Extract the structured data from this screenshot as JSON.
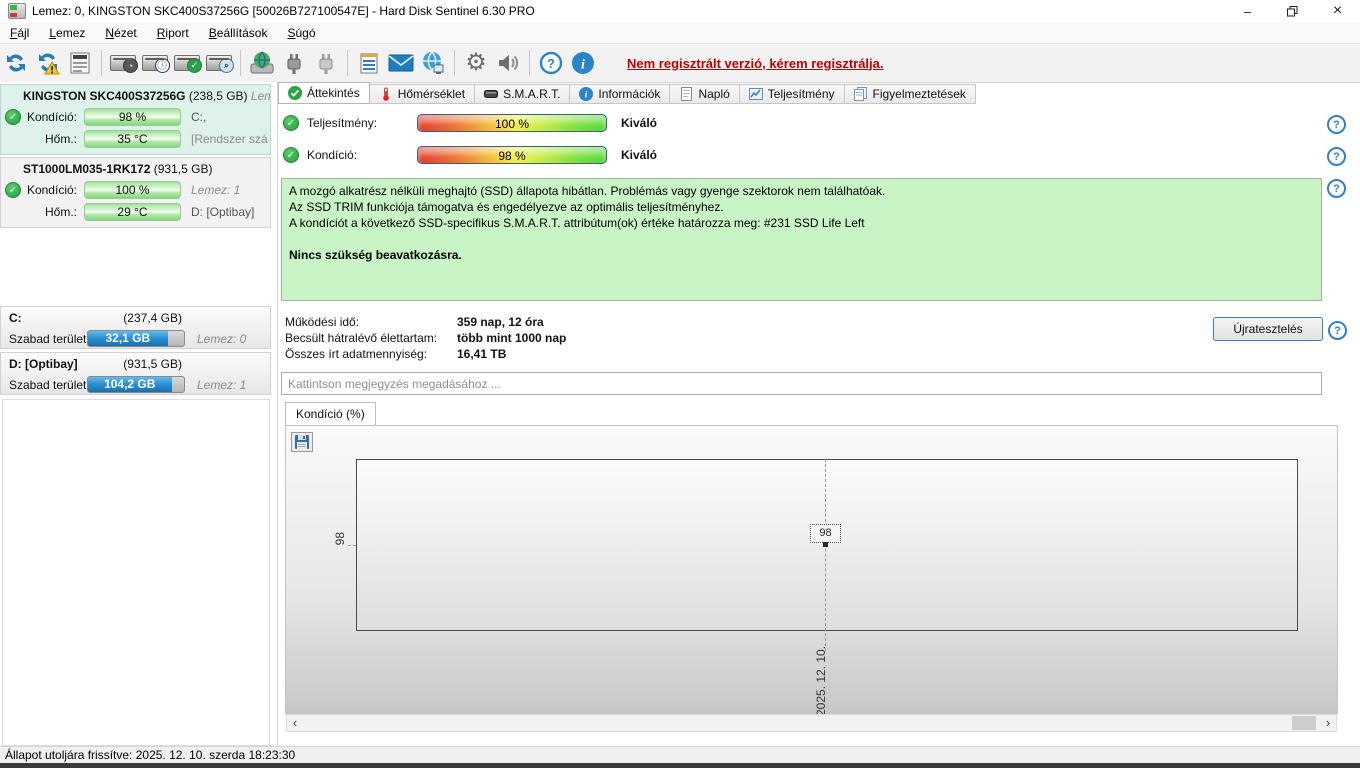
{
  "window": {
    "title": "Lemez: 0, KINGSTON SKC400S37256G [50026B727100547E]  -  Hard Disk Sentinel 6.30 PRO"
  },
  "menu": {
    "items": [
      {
        "label": "Fájl"
      },
      {
        "label": "Lemez"
      },
      {
        "label": "Nézet"
      },
      {
        "label": "Riport"
      },
      {
        "label": "Beállítások"
      },
      {
        "label": "Súgó"
      }
    ]
  },
  "toolbar": {
    "register_text": "Nem regisztrált verzió, kérem regisztrálja."
  },
  "tabs": [
    {
      "label": "Áttekintés",
      "active": true
    },
    {
      "label": "Hőmérséklet"
    },
    {
      "label": "S.M.A.R.T."
    },
    {
      "label": "Információk"
    },
    {
      "label": "Napló"
    },
    {
      "label": "Teljesítmény"
    },
    {
      "label": "Figyelmeztetések"
    }
  ],
  "sidebar": {
    "disks": [
      {
        "name": "KINGSTON SKC400S37256G",
        "size": "(238,5 GB)",
        "extra": "Lem",
        "rows": [
          {
            "label": "Kondíció:",
            "value": "98 %",
            "right": "C:,"
          },
          {
            "label": "Hőm.:",
            "value": "35 °C",
            "right": "[Rendszer szá"
          }
        ]
      },
      {
        "name": "ST1000LM035-1RK172",
        "size": "(931,5 GB)",
        "extra": "",
        "rows": [
          {
            "label": "Kondíció:",
            "value": "100 %",
            "right": "Lemez: 1"
          },
          {
            "label": "Hőm.:",
            "value": "29 °C",
            "right": "D: [Optibay]"
          }
        ]
      }
    ],
    "partitions": [
      {
        "name": "C:",
        "size": "(237,4 GB)",
        "free_label": "Szabad terület",
        "free_value": "32,1 GB",
        "right": "Lemez: 0",
        "used_pct": 86
      },
      {
        "name": "D: [Optibay]",
        "size": "(931,5 GB)",
        "free_label": "Szabad terület",
        "free_value": "104,2 GB",
        "right": "Lemez: 1",
        "used_pct": 89
      }
    ]
  },
  "overview": {
    "performance": {
      "label": "Teljesítmény:",
      "value": "100 %",
      "rating": "Kiváló"
    },
    "condition": {
      "label": "Kondíció:",
      "value": "98 %",
      "rating": "Kiváló"
    },
    "status_lines": [
      "A mozgó alkatrész nélküli meghajtó (SSD) állapota hibátlan. Problémás vagy gyenge szektorok nem találhatóak.",
      "Az SSD TRIM funkciója támogatva és engedélyezve az optimális teljesítményhez.",
      "A kondíciót a következő SSD-specifikus S.M.A.R.T. attribútum(ok) értéke határozza meg:  #231 SSD Life Left"
    ],
    "status_bold": "Nincs szükség beavatkozásra.",
    "stats": [
      {
        "label": "Működési idő:",
        "value": "359 nap, 12 óra"
      },
      {
        "label": "Becsült hátralévő élettartam:",
        "value": "több mint 1000 nap"
      },
      {
        "label": "Összes írt adatmennyiség:",
        "value": "16,41 TB"
      }
    ],
    "retest_button": "Újratesztelés",
    "comment_placeholder": "Kattintson megjegyzés megadásához ..."
  },
  "chart": {
    "tab_label": "Kondíció  (%)",
    "chart_data": {
      "type": "line",
      "title": "Kondíció (%)",
      "series": [
        {
          "name": "Kondíció (%)",
          "x": [
            "2025. 12. 10."
          ],
          "values": [
            98
          ]
        }
      ],
      "y_tick": "98",
      "x_tick": "2025. 12. 10.",
      "point_label": "98",
      "grid": "dashed-crosshair",
      "legend": "none"
    }
  },
  "statusbar": {
    "text": "Állapot utoljára frissítve: 2025. 12. 10. szerda 18:23:30"
  },
  "icons": {
    "minimize": "–",
    "close": "×",
    "check": "✓",
    "help": "?",
    "info": "i",
    "gear": "⚙",
    "scroll_left": "‹",
    "scroll_right": "›"
  },
  "colors": {
    "register_red": "#c00000",
    "health_green": "#2eaf4b",
    "accent_blue": "#2a84c8",
    "greenbox_bg": "#c9f4c6"
  }
}
